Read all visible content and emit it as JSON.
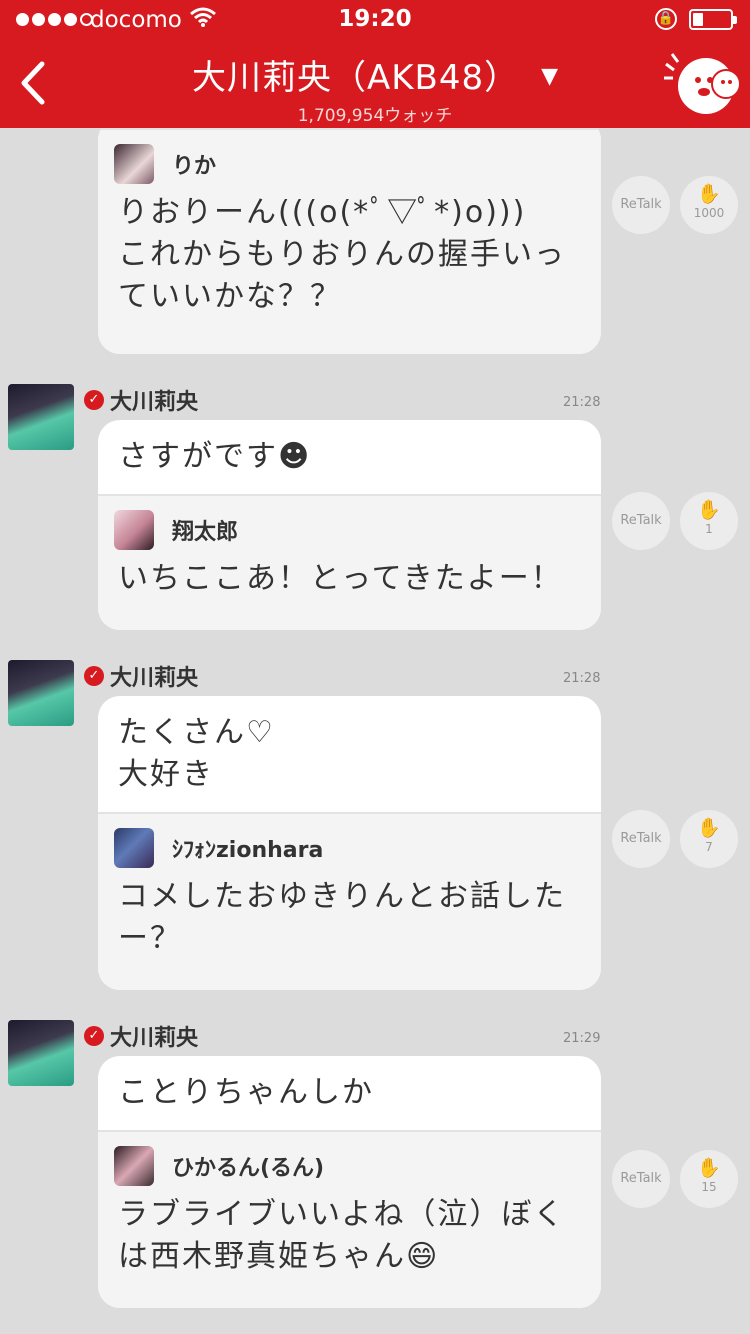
{
  "status_bar": {
    "carrier": "docomo",
    "time": "19:20"
  },
  "header": {
    "title": "大川莉央（AKB48）",
    "watch_count": "1,709,954ウォッチ"
  },
  "posts": [
    {
      "author": "",
      "time": "",
      "text": "",
      "quote": {
        "name": "りか",
        "text": "りおりーん(((o(*ﾟ▽ﾟ*)o)))\nこれからもりおりんの握手いっ\nていいかな？？"
      },
      "retalk": "ReTalk",
      "claps": "1000"
    },
    {
      "author": "大川莉央",
      "time": "21:28",
      "text": "さすがです☻",
      "quote": {
        "name": "翔太郎",
        "text": "いちここあ！とってきたよー！"
      },
      "retalk": "ReTalk",
      "claps": "1"
    },
    {
      "author": "大川莉央",
      "time": "21:28",
      "text": "たくさん♡\n大好き",
      "quote": {
        "name": "ｼﾌｫﾝzionhara",
        "text": "コメしたおゆきりんとお話した\nー？"
      },
      "retalk": "ReTalk",
      "claps": "7"
    },
    {
      "author": "大川莉央",
      "time": "21:29",
      "text": "ことりちゃんしか",
      "quote": {
        "name": "ひかるん(るん)",
        "text": "ラブライブいいよね（泣）ぼく\nは西木野真姫ちゃん😄"
      },
      "retalk": "ReTalk",
      "claps": "15"
    }
  ],
  "colors": {
    "brand": "#d71a1f",
    "background": "#dcdcdc"
  },
  "icons": [
    "back-icon",
    "wifi-icon",
    "rotation-lock-icon",
    "battery-icon",
    "dropdown-caret-icon",
    "mascot-icon",
    "verified-icon",
    "clap-icon"
  ]
}
